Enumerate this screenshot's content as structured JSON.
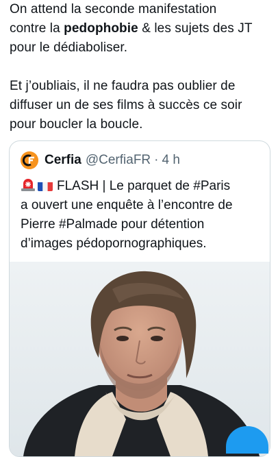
{
  "tweet": {
    "text_line1": "On attend la seconde manifestation",
    "text_line2_prefix": "contre la ",
    "text_line2_bold": "pedophobie",
    "text_line2_suffix": " & les sujets des JT",
    "text_line3": "pour le dédiaboliser.",
    "text_line4": "Et j’oubliais, il ne faudra pas oublier de",
    "text_line5": "diffuser un de ses films à succès ce soir",
    "text_line6": "pour boucler la boucle."
  },
  "quoted_tweet": {
    "author_name": "Cerfia",
    "author_handle": "@CerfiaFR",
    "separator": "·",
    "time": "4 h",
    "avatar_letters": "CF",
    "body_line1": "FLASH | Le parquet de #Paris",
    "body_line2": "a ouvert une enquête à l’encontre de",
    "body_line3": "Pierre #Palmade pour détention",
    "body_line4": "d’images pédopornographiques.",
    "emoji": [
      "siren-icon",
      "france-flag-icon"
    ]
  },
  "colors": {
    "text": "#0f1419",
    "secondary": "#536471",
    "border": "#cfd9de",
    "accent": "#1d9bf0",
    "avatar": "#f7931e"
  }
}
